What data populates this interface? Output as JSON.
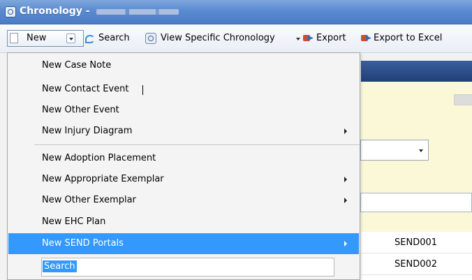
{
  "window": {
    "title": "Chronology -"
  },
  "toolbar": {
    "new_label": "New",
    "search_label": "Search",
    "view_specific_label": "View Specific Chronology",
    "export_label": "Export",
    "export_excel_label": "Export to Excel"
  },
  "menu": {
    "items": [
      {
        "label": "New Case Note",
        "submenu": false
      },
      {
        "label": "New Contact Event",
        "submenu": false
      },
      {
        "label": "New Other Event",
        "submenu": false
      },
      {
        "label": "New Injury Diagram",
        "submenu": true
      },
      {
        "label": "New Adoption Placement",
        "submenu": false
      },
      {
        "label": "New Appropriate Exemplar",
        "submenu": true
      },
      {
        "label": "New Other Exemplar",
        "submenu": true
      },
      {
        "label": "New EHC Plan",
        "submenu": false
      },
      {
        "label": "New SEND Portals",
        "submenu": true,
        "highlighted": true
      }
    ],
    "search_value": "Search"
  },
  "background_grid": {
    "rows": [
      "SEND001",
      "SEND002"
    ]
  },
  "colors": {
    "title_bar": "#5a8ad0",
    "highlight": "#3399ff",
    "panel_yellow": "#fbf8d8",
    "band_blue": "#2b4d8a"
  }
}
